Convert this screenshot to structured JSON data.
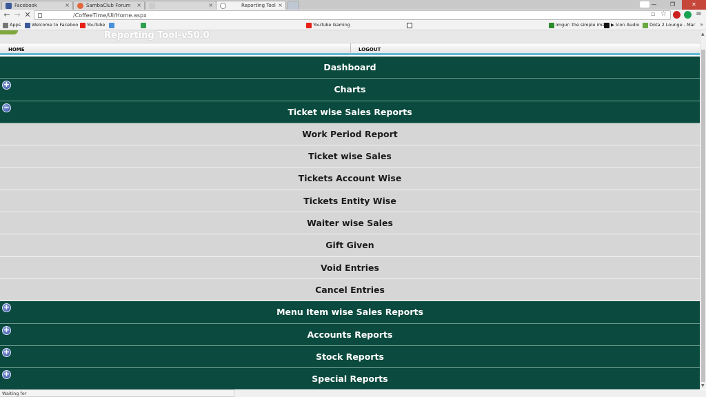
{
  "browser": {
    "tabs": [
      {
        "label": "Facebook",
        "favicon_color": "#3b5998"
      },
      {
        "label": "SambaClub Forum",
        "favicon_color": "#e2683c"
      },
      {
        "label": "",
        "favicon_color": "#cccccc"
      },
      {
        "label": "Reporting Tool",
        "favicon_color": "#ffffff"
      }
    ],
    "close_glyph": "×",
    "window": {
      "minimize": "—",
      "maximize": "❐",
      "close": "✕"
    },
    "url": "/CoffeeTime/UI/Home.aspx",
    "back_icon": "back-arrow-icon",
    "forward_icon": "forward-arrow-icon",
    "stop_icon": "stop-icon",
    "bookmarks": [
      {
        "label": "Apps",
        "color": "#6a6a6a"
      },
      {
        "label": "Welcome to Faceboo",
        "color": "#3b5998"
      },
      {
        "label": "YouTube",
        "color": "#e62117"
      },
      {
        "label": "",
        "color": "#4a90d9"
      },
      {
        "label": "",
        "color": "#2e9e4f"
      },
      {
        "label": "YouTube Gaming",
        "color": "#e62117"
      },
      {
        "label": "",
        "color": "#333333"
      },
      {
        "label": "imgur: the simple ima",
        "color": "#2c8c2c"
      },
      {
        "label": "▶ Icon Audio",
        "color": "#111111"
      },
      {
        "label": "Dota 2 Lounge - Mar",
        "color": "#6aa842"
      }
    ],
    "more_bookmarks": "»",
    "status_text": "Waiting for"
  },
  "app": {
    "title": "Reporting Tool-v50.0",
    "nav": {
      "home": "HOME",
      "logout": "LOGOUT"
    },
    "expand_glyph": "+",
    "collapse_glyph": "−"
  },
  "menu": [
    {
      "label": "Dashboard",
      "kind": "section",
      "toggle": "none"
    },
    {
      "label": "Charts",
      "kind": "section",
      "toggle": "expand"
    },
    {
      "label": "Ticket wise Sales Reports",
      "kind": "section",
      "toggle": "collapse"
    },
    {
      "label": "Work Period Report",
      "kind": "item"
    },
    {
      "label": "Ticket wise Sales",
      "kind": "item"
    },
    {
      "label": "Tickets Account Wise",
      "kind": "item"
    },
    {
      "label": "Tickets Entity Wise",
      "kind": "item"
    },
    {
      "label": "Waiter wise Sales",
      "kind": "item"
    },
    {
      "label": "Gift Given",
      "kind": "item"
    },
    {
      "label": "Void Entries",
      "kind": "item"
    },
    {
      "label": "Cancel Entries",
      "kind": "item"
    },
    {
      "label": "Menu Item wise Sales Reports",
      "kind": "section",
      "toggle": "expand"
    },
    {
      "label": "Accounts Reports",
      "kind": "section",
      "toggle": "expand"
    },
    {
      "label": "Stock Reports",
      "kind": "section",
      "toggle": "expand"
    },
    {
      "label": "Special Reports",
      "kind": "section",
      "toggle": "expand"
    }
  ],
  "colors": {
    "section_bg": "#0b4a3e",
    "item_bg": "#d6d6d6",
    "nav_accent": "#5fb9d6"
  }
}
